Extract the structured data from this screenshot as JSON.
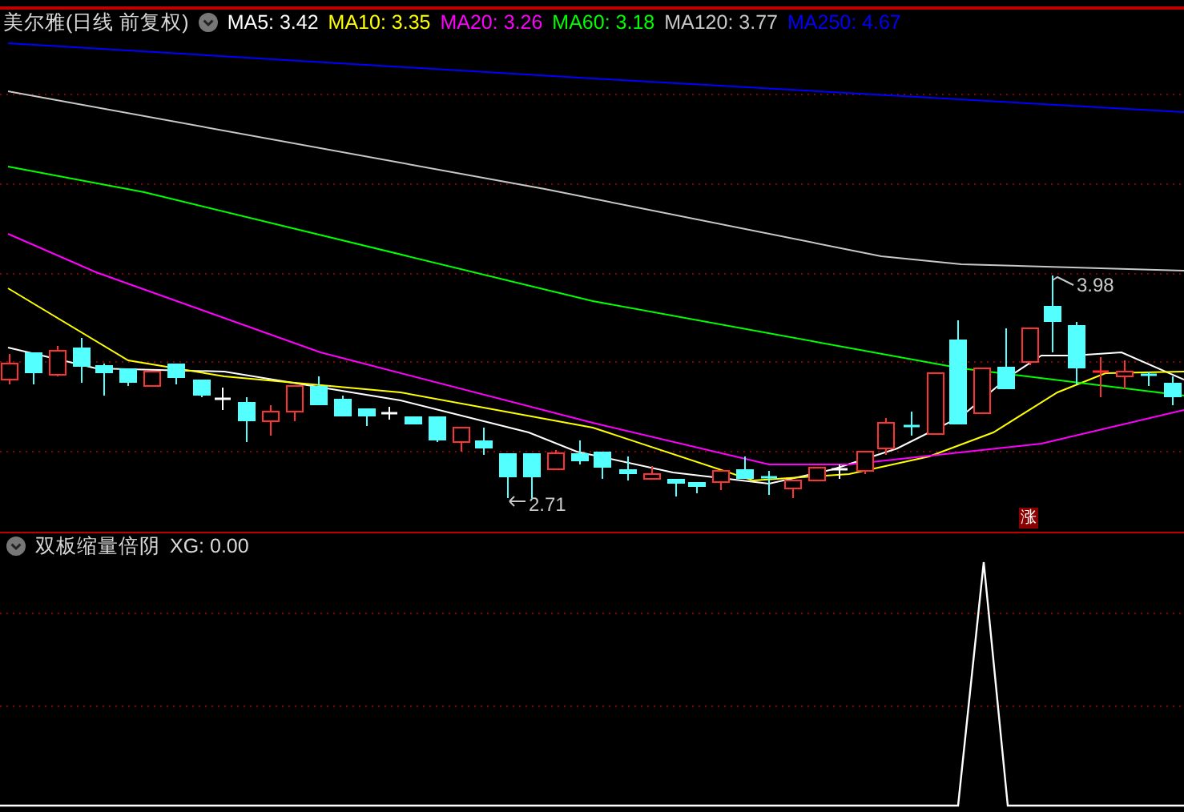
{
  "security": {
    "name": "美尔雅(日线 前复权)"
  },
  "moving_averages": [
    {
      "label": "MA5: 3.42",
      "color": "#ffffff"
    },
    {
      "label": "MA10: 3.35",
      "color": "#ffff00"
    },
    {
      "label": "MA20: 3.26",
      "color": "#ff00ff"
    },
    {
      "label": "MA60: 3.18",
      "color": "#00ff00"
    },
    {
      "label": "MA120: 3.77",
      "color": "#c8c8c8"
    },
    {
      "label": "MA250: 4.67",
      "color": "#0000ff"
    }
  ],
  "main_chart": {
    "high_label": "3.98",
    "low_label": "2.71",
    "badge": "涨"
  },
  "indicator": {
    "name": "双板缩量倍阴",
    "reading": "XG: 0.00"
  }
}
